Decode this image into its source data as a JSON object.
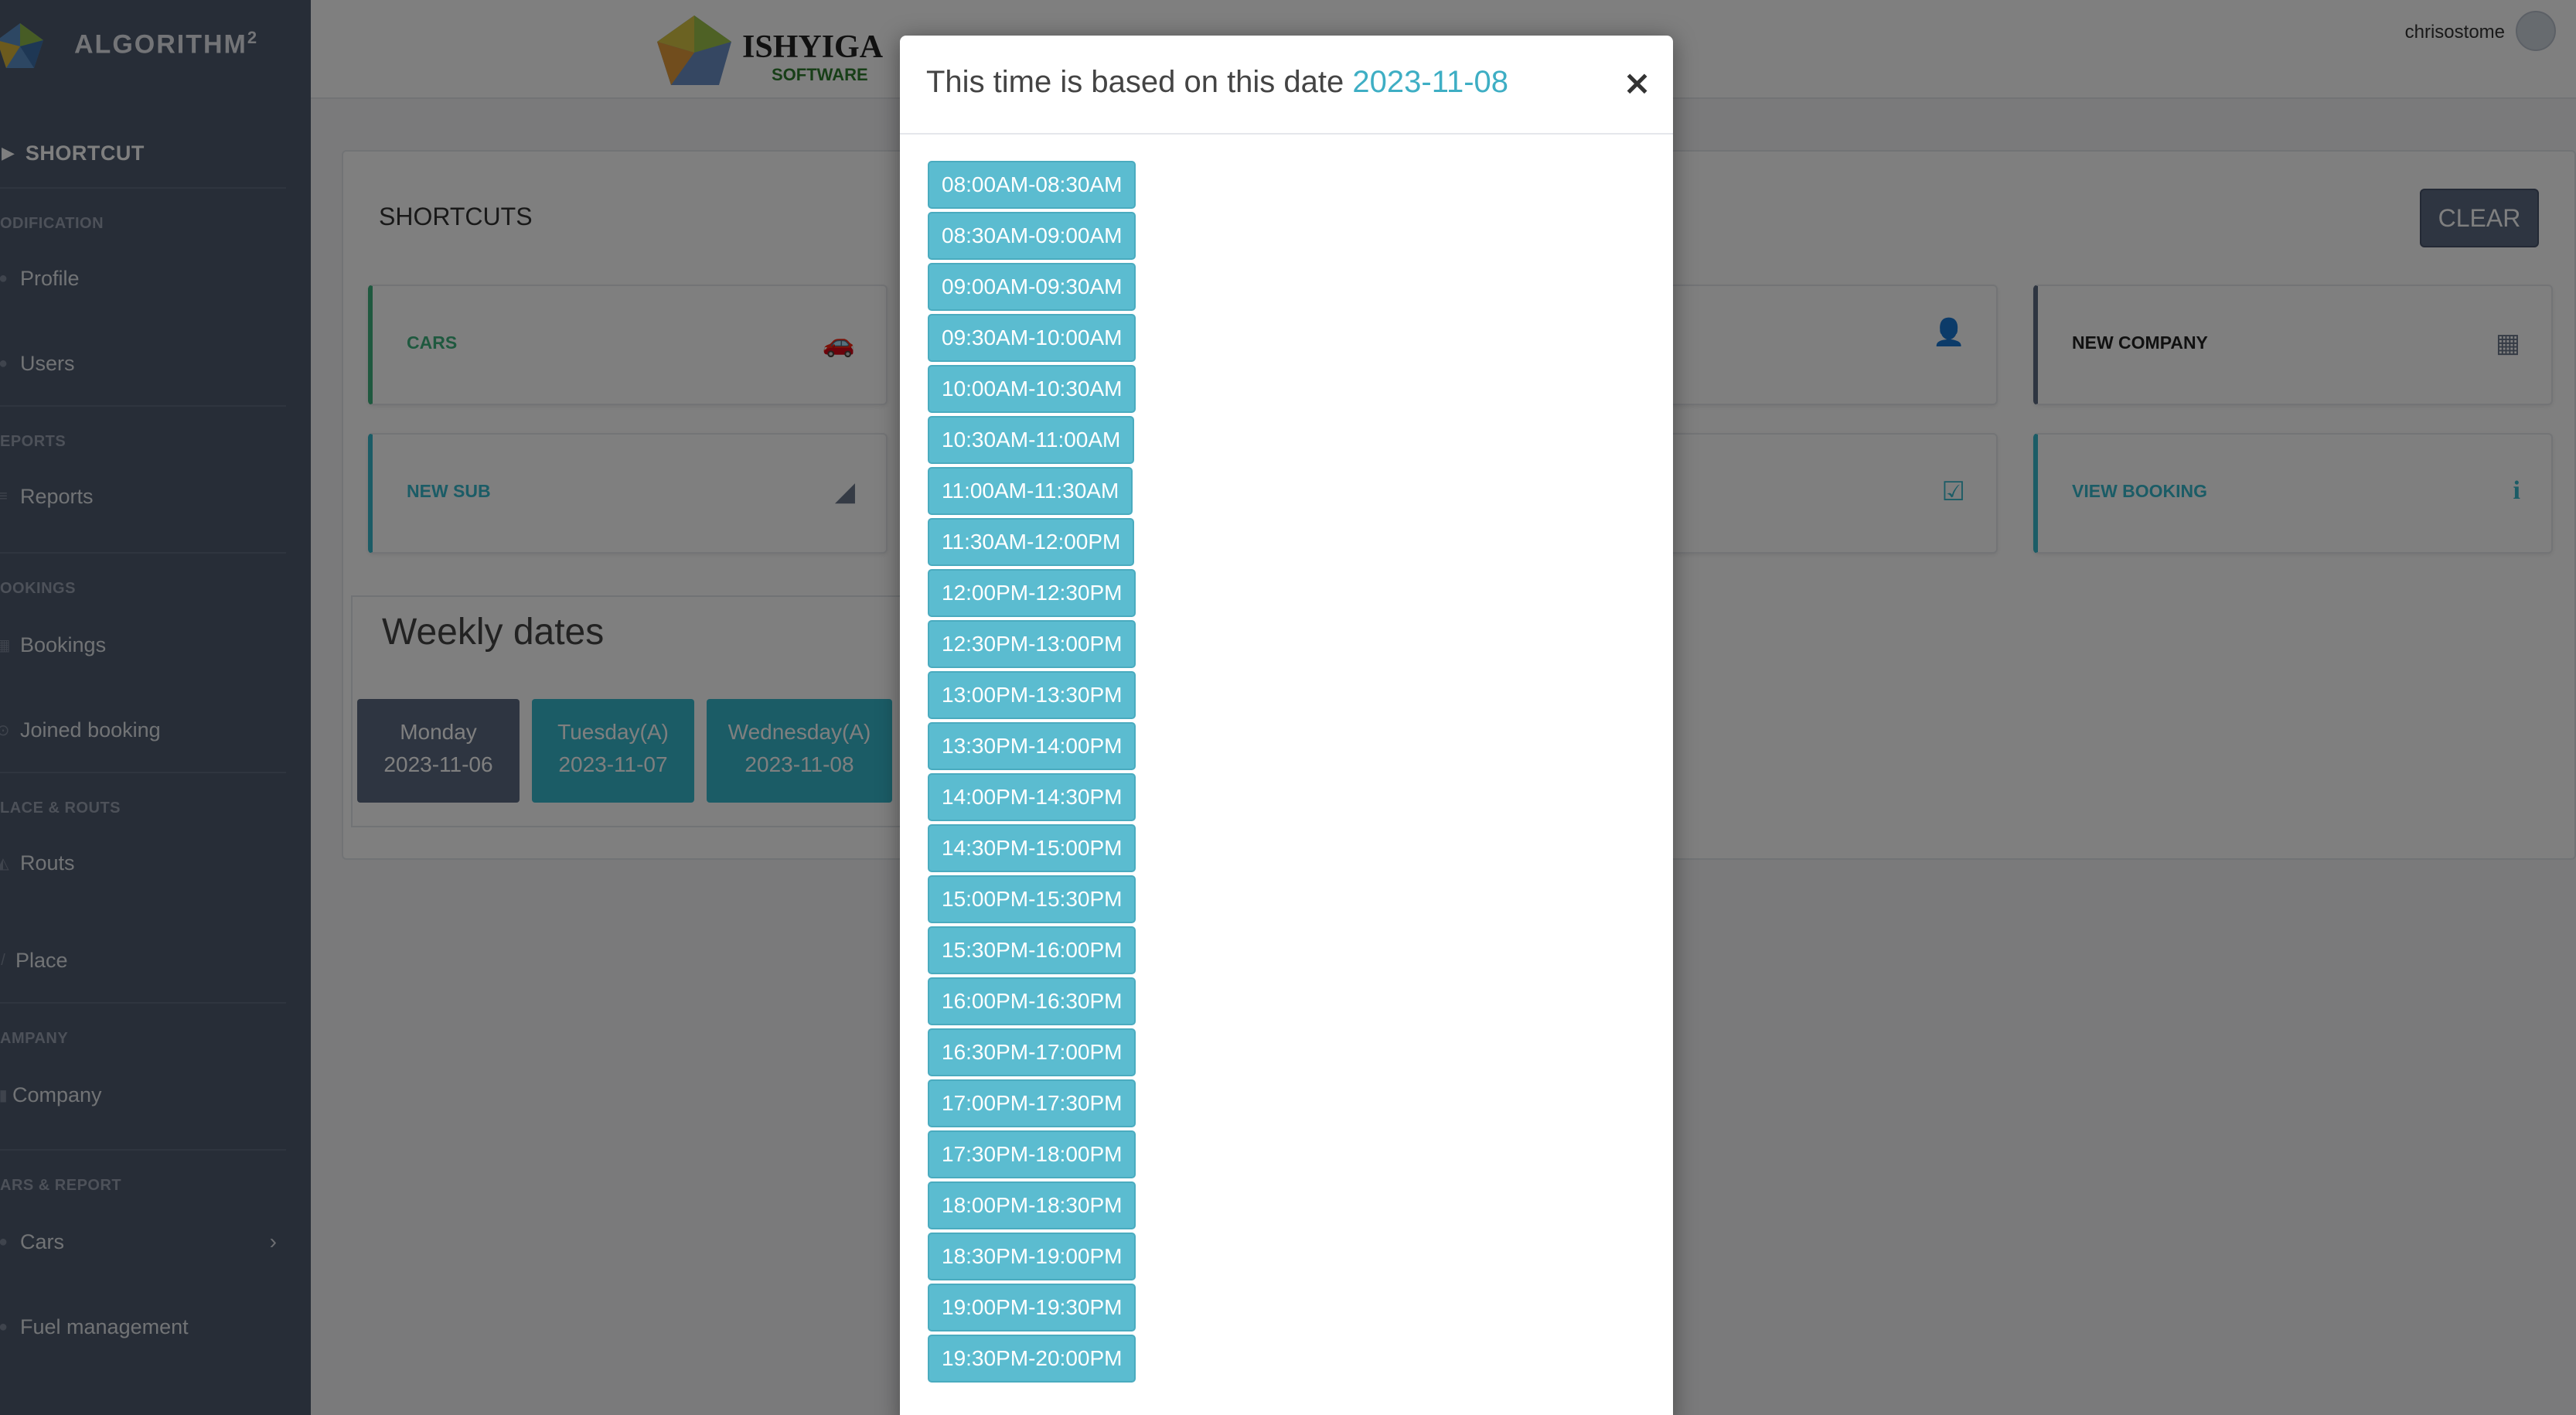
{
  "sidebar": {
    "brand": "ALGORITHM",
    "brand_sup": "2",
    "shortcut_label": "SHORTCUT",
    "sections": {
      "modification": "ODIFICATION",
      "reports": "EPORTS",
      "bookings": "OOKINGS",
      "place": "LACE & ROUTS",
      "company": "AMPANY",
      "cars": "ARS & REPORT"
    },
    "items": {
      "profile": "Profile",
      "users": "Users",
      "reports": "Reports",
      "bookings": "Bookings",
      "joined": "Joined booking",
      "routs": "Routs",
      "place": "Place",
      "company": "Company",
      "cars": "Cars",
      "fuel": "Fuel management"
    }
  },
  "topbar": {
    "company_logo_text": "ISHYIGA",
    "company_logo_sub": "SOFTWARE",
    "user_name": "chrisostome"
  },
  "main": {
    "shortcuts_title": "SHORTCUTS",
    "clear_label": "CLEAR",
    "cards": {
      "cars": "CARS",
      "new_company": "NEW COMPANY",
      "new_sub": "NEW SUB",
      "view_booking": "VIEW BOOKING"
    },
    "weekly_title": "Weekly dates",
    "days": [
      {
        "day": "Monday",
        "date": "2023-11-06"
      },
      {
        "day": "Tuesday(A)",
        "date": "2023-11-07"
      },
      {
        "day": "Wednesday(A)",
        "date": "2023-11-08"
      }
    ]
  },
  "modal": {
    "title_prefix": "This time is based on this date",
    "date": "2023-11-08",
    "close": "×",
    "slots": [
      "08:00AM-08:30AM",
      "08:30AM-09:00AM",
      "09:00AM-09:30AM",
      "09:30AM-10:00AM",
      "10:00AM-10:30AM",
      "10:30AM-11:00AM",
      "11:00AM-11:30AM",
      "11:30AM-12:00PM",
      "12:00PM-12:30PM",
      "12:30PM-13:00PM",
      "13:00PM-13:30PM",
      "13:30PM-14:00PM",
      "14:00PM-14:30PM",
      "14:30PM-15:00PM",
      "15:00PM-15:30PM",
      "15:30PM-16:00PM",
      "16:00PM-16:30PM",
      "16:30PM-17:00PM",
      "17:00PM-17:30PM",
      "17:30PM-18:00PM",
      "18:00PM-18:30PM",
      "18:30PM-19:00PM",
      "19:00PM-19:30PM",
      "19:30PM-20:00PM"
    ]
  },
  "colors": {
    "sidebar": "#4e5a6f",
    "accent_teal": "#3eaec4",
    "slot_bg": "#5bbcd0",
    "card_green": "#3fb27f",
    "card_purple": "#5d6b82",
    "card_teal": "#36b9cc",
    "monday_bg": "#5d6b82"
  },
  "icons": {
    "cars": "car-icon",
    "company": "building-icon",
    "sub": "chart-icon",
    "booking": "info-icon",
    "user": "user-icon",
    "check": "check-square-icon"
  }
}
